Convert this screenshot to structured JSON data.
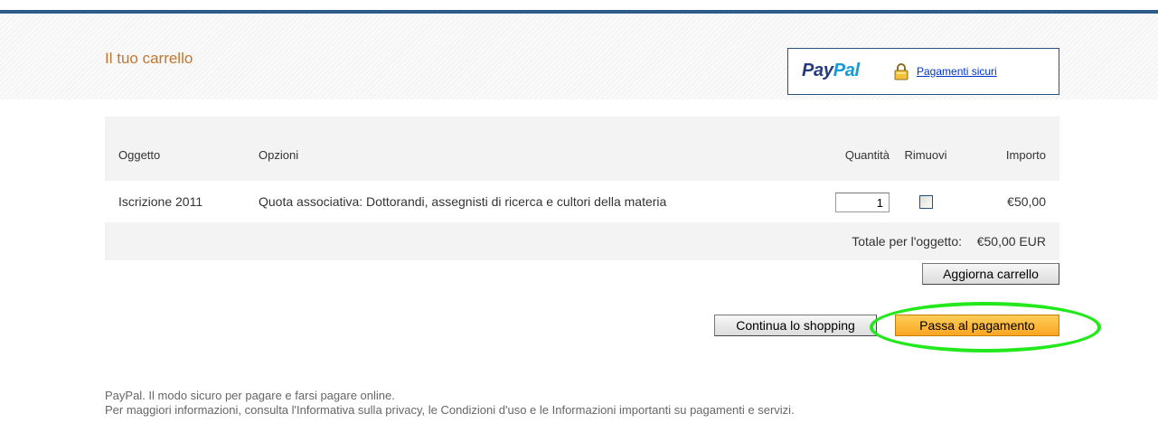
{
  "cart": {
    "title": "Il tuo carrello"
  },
  "secure_box": {
    "logo_pay": "Pay",
    "logo_pal": "Pal",
    "link_label": "Pagamenti sicuri"
  },
  "table": {
    "headers": [
      "Oggetto",
      "Opzioni",
      "Quantità",
      "Rimuovi",
      "Importo"
    ],
    "rows": [
      {
        "item": "Iscrizione 2011",
        "options": "Quota associativa: Dottorandi, assegnisti di ricerca e cultori della materia",
        "quantity": "1",
        "remove_checked": false,
        "amount": "€50,00"
      }
    ],
    "total_label": "Totale per l'oggetto:",
    "total_value": "€50,00 EUR"
  },
  "buttons": {
    "update_cart": "Aggiorna carrello",
    "continue_shopping": "Continua lo shopping",
    "checkout": "Passa al pagamento"
  },
  "colors": {
    "title": "#c5752d",
    "checkout_button": "#f9a622",
    "highlight": "#23e81b",
    "top_bar": "#2e5c8a"
  },
  "footer": {
    "line1": "PayPal. Il modo sicuro per pagare e farsi pagare online.",
    "line2": "Per maggiori informazioni, consulta l'Informativa sulla privacy, le Condizioni d'uso e le Informazioni importanti su pagamenti e servizi."
  }
}
